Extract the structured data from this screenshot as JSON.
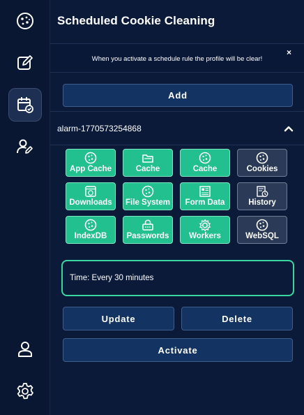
{
  "sidebar": {
    "items": [
      {
        "name": "cookie-logo-icon",
        "active": false
      },
      {
        "name": "edit-icon",
        "active": false
      },
      {
        "name": "calendar-check-icon",
        "active": true
      },
      {
        "name": "user-edit-icon",
        "active": false
      },
      {
        "name": "user-icon",
        "active": false
      },
      {
        "name": "settings-icon",
        "active": false
      }
    ]
  },
  "header": {
    "title": "Scheduled Cookie Cleaning"
  },
  "notice": {
    "text": "When you activate a schedule rule the profile will be clear!",
    "close_label": "×"
  },
  "actions": {
    "add_label": "Add"
  },
  "rule": {
    "name": "alarm-1770573254868",
    "expanded": true,
    "data_types": [
      {
        "label": "App Cache",
        "icon": "cookie-icon",
        "enabled": true
      },
      {
        "label": "Cache",
        "icon": "folder-cache-icon",
        "enabled": true
      },
      {
        "label": "Cache",
        "icon": "cookie-icon",
        "enabled": true
      },
      {
        "label": "Cookies",
        "icon": "cookie-icon",
        "enabled": false
      },
      {
        "label": "Downloads",
        "icon": "download-icon",
        "enabled": true
      },
      {
        "label": "File System",
        "icon": "cookie-icon",
        "enabled": true
      },
      {
        "label": "Form Data",
        "icon": "form-icon",
        "enabled": true
      },
      {
        "label": "History",
        "icon": "history-icon",
        "enabled": false
      },
      {
        "label": "IndexDB",
        "icon": "cookie-icon",
        "enabled": true
      },
      {
        "label": "Passwords",
        "icon": "password-icon",
        "enabled": true
      },
      {
        "label": "Workers",
        "icon": "worker-icon",
        "enabled": true
      },
      {
        "label": "WebSQL",
        "icon": "cookie-icon",
        "enabled": false
      }
    ],
    "time_text": "Time: Every 30 minutes",
    "update_label": "Update",
    "delete_label": "Delete",
    "activate_label": "Activate"
  },
  "colors": {
    "background": "#0c1a3a",
    "enabled_tile": "#21c08e",
    "disabled_tile": "#2b3a57",
    "button": "#133463",
    "time_border": "#3ad6a0"
  }
}
